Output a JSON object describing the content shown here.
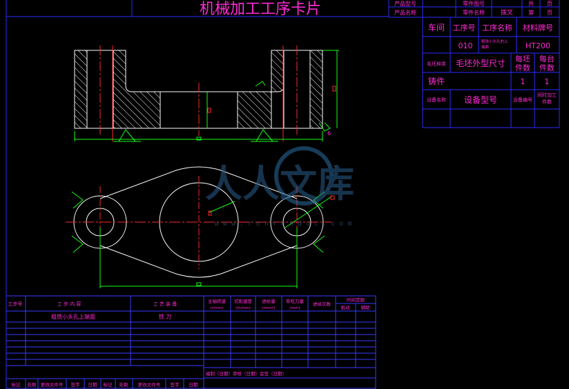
{
  "title": "机械加工工序卡片",
  "header": {
    "product_model_label": "产品型号",
    "part_drawing_no_label": "零件图号",
    "total_label": "共",
    "page_unit_1": "页",
    "product_name_label": "产品名称",
    "part_name_label": "零件名称",
    "part_name_value": "拨叉",
    "page_no_label": "第",
    "page_unit_2": "页"
  },
  "info": {
    "workshop_label": "车间",
    "process_no_label": "工序号",
    "process_name_label": "工序名称",
    "material_label": "材料牌号",
    "process_no_value": "010",
    "process_name_value_1": "粗铣小头孔的上",
    "process_name_value_2": "端面",
    "material_value": "HT200",
    "blank_type_label": "毛坯种类",
    "blank_size_label": "毛坯外型尺寸",
    "parts_per_blank_label_1": "每坯",
    "parts_per_blank_label_2": "件数",
    "parts_per_unit_label_1": "每台",
    "parts_per_unit_label_2": "件数",
    "blank_type_value": "铸件",
    "parts_per_blank_value": "1",
    "parts_per_unit_value": "1",
    "equipment_name_label": "设备名称",
    "equipment_model_label": "设备型号",
    "equipment_no_label": "设备编号",
    "simultaneous_label_1": "同时加工",
    "simultaneous_label_2": "件数"
  },
  "watermark": {
    "text": "人人文库",
    "url": "w w w . r e n r e n d o c . c o m"
  },
  "process_table": {
    "headers": {
      "step_no": "工步号",
      "step_content": "工 步 内 容",
      "equipment": "工 艺 装 备",
      "spindle_speed_1": "主轴转速",
      "spindle_speed_2": "(r/min)",
      "cutting_speed_1": "切削速度",
      "cutting_speed_2": "(m/min)",
      "feed_1": "进给量",
      "feed_2": "(mm/r)",
      "depth_1": "背吃刀量",
      "depth_2": "(mm)",
      "passes": "进给次数",
      "time_quota": "时间定额",
      "machine_time": "机动",
      "aux_time": "辅助"
    },
    "rows": [
      {
        "step_content": "粗铣小头孔上端面",
        "equipment": "铣 刀"
      }
    ],
    "sign_row": "编制（日期）审核（日期）会签（日期）",
    "footer": [
      "标记",
      "处数",
      "更改文件号",
      "签字",
      "日期",
      "标记",
      "处数",
      "更改文件号",
      "签字",
      "日期"
    ]
  }
}
